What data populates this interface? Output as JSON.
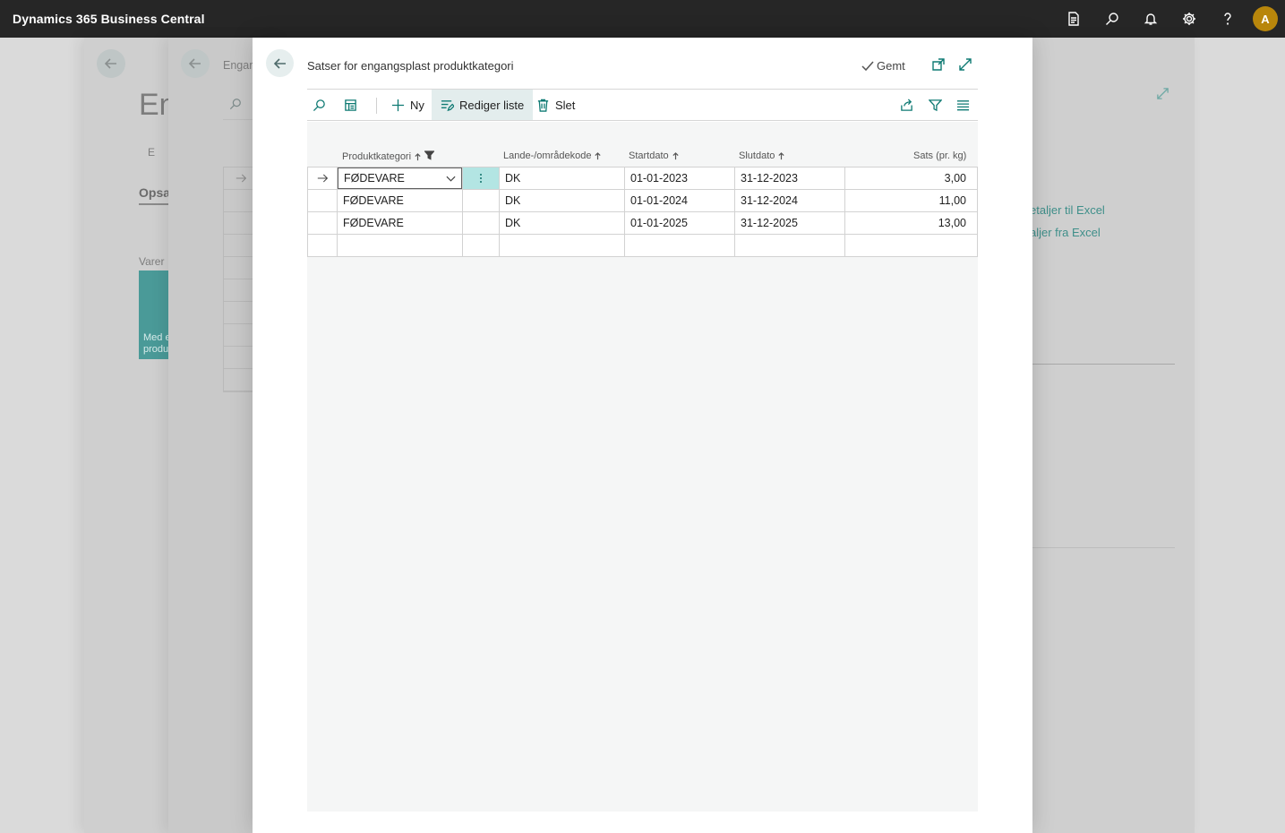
{
  "app": {
    "title": "Dynamics 365 Business Central",
    "avatar_initial": "A"
  },
  "background": {
    "page2_title_fragment": "En",
    "page2_action_fragment": "E",
    "page2_section_fragment": "Opsa",
    "page2_tiles_label": "Varer",
    "page2_tile_line1": "Med e",
    "page2_tile_line2": "produ",
    "page3_title_fragment": "Engar",
    "link_excel_to": "etaljer til Excel",
    "link_excel_from": "aljer fra Excel"
  },
  "dialog": {
    "title": "Satser for engangsplast produktkategori",
    "saved_label": "Gemt",
    "actions": {
      "new_label": "Ny",
      "edit_list_label": "Rediger liste",
      "delete_label": "Slet"
    },
    "columns": {
      "category": "Produktkategori",
      "country": "Lande-/områdekode",
      "start": "Startdato",
      "end": "Slutdato",
      "rate": "Sats (pr. kg)"
    },
    "rows": [
      {
        "category": "FØDEVARE",
        "country": "DK",
        "start": "01-01-2023",
        "end": "31-12-2023",
        "rate": "3,00"
      },
      {
        "category": "FØDEVARE",
        "country": "DK",
        "start": "01-01-2024",
        "end": "31-12-2024",
        "rate": "11,00"
      },
      {
        "category": "FØDEVARE",
        "country": "DK",
        "start": "01-01-2025",
        "end": "31-12-2025",
        "rate": "13,00"
      }
    ]
  },
  "colors": {
    "appbar": "#262626",
    "accent": "#0f7a73",
    "selected_cell": "#b3e5e3",
    "avatar": "#b8860b"
  }
}
